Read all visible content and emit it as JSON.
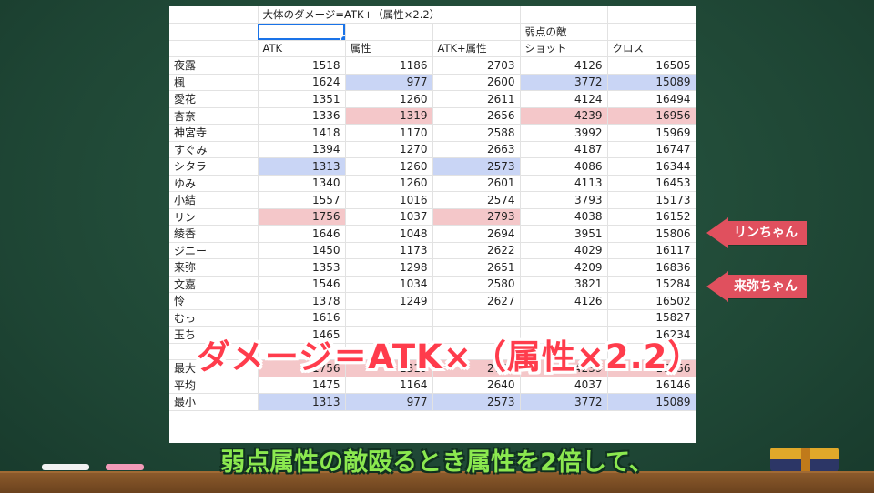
{
  "sheet": {
    "title": "大体のダメージ=ATK+（属性×2.2）",
    "weak_enemy_label": "弱点の敵",
    "headers": [
      "ATK",
      "属性",
      "ATK+属性",
      "ショット",
      "クロス"
    ],
    "rows": [
      {
        "name": "夜露",
        "values": [
          "1518",
          "1186",
          "2703",
          "4126",
          "16505"
        ]
      },
      {
        "name": "楓",
        "values": [
          "1624",
          "977",
          "2600",
          "3772",
          "15089"
        ]
      },
      {
        "name": "愛花",
        "values": [
          "1351",
          "1260",
          "2611",
          "4124",
          "16494"
        ]
      },
      {
        "name": "杏奈",
        "values": [
          "1336",
          "1319",
          "2656",
          "4239",
          "16956"
        ]
      },
      {
        "name": "神宮寺",
        "values": [
          "1418",
          "1170",
          "2588",
          "3992",
          "15969"
        ]
      },
      {
        "name": "すぐみ",
        "values": [
          "1394",
          "1270",
          "2663",
          "4187",
          "16747"
        ]
      },
      {
        "name": "シタラ",
        "values": [
          "1313",
          "1260",
          "2573",
          "4086",
          "16344"
        ]
      },
      {
        "name": "ゆみ",
        "values": [
          "1340",
          "1260",
          "2601",
          "4113",
          "16453"
        ]
      },
      {
        "name": "小結",
        "values": [
          "1557",
          "1016",
          "2574",
          "3793",
          "15173"
        ]
      },
      {
        "name": "リン",
        "values": [
          "1756",
          "1037",
          "2793",
          "4038",
          "16152"
        ]
      },
      {
        "name": "綾香",
        "values": [
          "1646",
          "1048",
          "2694",
          "3951",
          "15806"
        ]
      },
      {
        "name": "ジニー",
        "values": [
          "1450",
          "1173",
          "2622",
          "4029",
          "16117"
        ]
      },
      {
        "name": "来弥",
        "values": [
          "1353",
          "1298",
          "2651",
          "4209",
          "16836"
        ]
      },
      {
        "name": "文嘉",
        "values": [
          "1546",
          "1034",
          "2580",
          "3821",
          "15284"
        ]
      },
      {
        "name": "怜",
        "values": [
          "1378",
          "1249",
          "2627",
          "4126",
          "16502"
        ]
      },
      {
        "name": "むっ",
        "values": [
          "1616",
          "",
          "",
          "",
          "15827"
        ]
      },
      {
        "name": "玉ち",
        "values": [
          "1465",
          "",
          "",
          "",
          "16234"
        ]
      }
    ],
    "stats": [
      {
        "name": "最大",
        "values": [
          "1756",
          "1319",
          "2793",
          "4239",
          "16956"
        ]
      },
      {
        "name": "平均",
        "values": [
          "1475",
          "1164",
          "2640",
          "4037",
          "16146"
        ]
      },
      {
        "name": "最小",
        "values": [
          "1313",
          "977",
          "2573",
          "3772",
          "15089"
        ]
      }
    ]
  },
  "overlay_formula": "ダメージ＝ATK×（属性×2.2）",
  "callouts": {
    "rin": "リンちゃん",
    "raiya": "来弥ちゃん"
  },
  "subtitle": "弱点属性の敵殴るとき属性を2倍して、",
  "colors": {
    "max_highlight": "#f4c7c9",
    "min_highlight": "#c9d5f5",
    "overlay_text": "#ff3c4c",
    "subtitle_text": "#8be84f",
    "callout_bg": "#e0505e"
  }
}
